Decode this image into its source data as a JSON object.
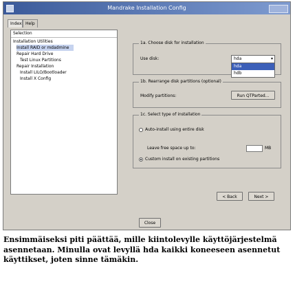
{
  "window": {
    "title": "Mandrake Installation Config"
  },
  "tabs": [
    {
      "label": "Index"
    },
    {
      "label": "Help"
    }
  ],
  "tree": {
    "header": "Selection",
    "items": [
      {
        "label": "Installation Utilities"
      },
      {
        "label": "Install RAID or mdadmine"
      },
      {
        "label": "Repair Hard Drive"
      },
      {
        "label": "Test Linux Partitions"
      },
      {
        "label": "Repair Installation"
      },
      {
        "label": "Install LILO/Bootloader"
      },
      {
        "label": "Install X Config"
      }
    ]
  },
  "section1": {
    "title": "1a. Choose disk for installation",
    "use_disk_label": "Use disk:",
    "selected_disk": "hda",
    "options": [
      "hda",
      "hdb"
    ]
  },
  "section2": {
    "title": "1b. Rearrange disk partitions (optional)",
    "modify_label": "Modify partitions:",
    "button_label": "Run QTParted..."
  },
  "section3": {
    "title": "1c. Select type of installation",
    "option_auto": "Auto-install using entire disk",
    "free_space_label": "Leave free space up to:",
    "free_space_unit": "MB",
    "option_custom": "Custom install on existing partitions",
    "selected_option": "custom"
  },
  "nav": {
    "back_label": "< Back",
    "next_label": "Next >",
    "close_label": "Close"
  },
  "caption": {
    "text": "Ensimmäiseksi piti päättää, mille kiintolevylle käyttöjärjestelmä asennetaan. Minulla ovat levyllä hda kaikki koneeseen asennetut käyttikset, joten sinne tämäkin."
  }
}
